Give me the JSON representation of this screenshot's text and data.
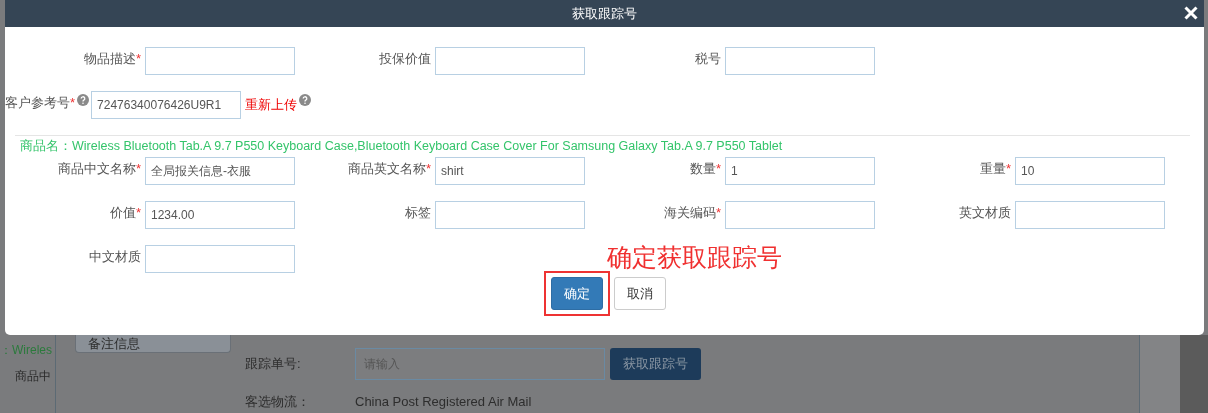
{
  "dialog": {
    "title": "获取跟踪号",
    "top_rows": [
      [
        {
          "label": "物品描述",
          "required_mark": "*"
        },
        {
          "label": "投保价值"
        },
        {
          "label": "税号"
        }
      ],
      [
        {
          "label": "客户参考号",
          "required_mark": "*",
          "help": true,
          "value": "72476340076426U9R1",
          "link": "重新上传",
          "link_help": true
        }
      ]
    ],
    "product_name": "商品名：Wireless Bluetooth Tab.A 9.7 P550 Keyboard Case,Bluetooth Keyboard Case Cover For Samsung Galaxy Tab.A 9.7 P550 Tablet",
    "product_rows": [
      [
        {
          "label": "商品中文名称",
          "required_mark": "*",
          "value": "全局报关信息-衣服"
        },
        {
          "label": "商品英文名称",
          "required_mark": "*",
          "value": "shirt"
        },
        {
          "label": "数量",
          "required_mark": "*",
          "value": "1"
        },
        {
          "label": "重量",
          "required_mark": "*",
          "value": "10"
        }
      ],
      [
        {
          "label": "价值",
          "required_mark": "*",
          "value": "1234.00"
        },
        {
          "label": "标签"
        },
        {
          "label": "海关编码",
          "required_mark": "*"
        },
        {
          "label": "英文材质"
        }
      ],
      [
        {
          "label": "中文材质"
        }
      ]
    ],
    "annotation": "确定获取跟踪号",
    "buttons": [
      {
        "label": "确定",
        "kind": "primary",
        "highlighted": true
      },
      {
        "label": "取消",
        "kind": "default",
        "highlighted": false
      }
    ]
  },
  "background": {
    "product_fragment": "：Wireles",
    "label_fragment": "商品中",
    "tab": "备注信息",
    "tracking_label": "跟踪单号:",
    "tracking_placeholder": "请输入",
    "tracking_button": "获取跟踪号",
    "shipping_label": "客选物流：",
    "shipping_value": "China Post Registered Air Mail"
  }
}
